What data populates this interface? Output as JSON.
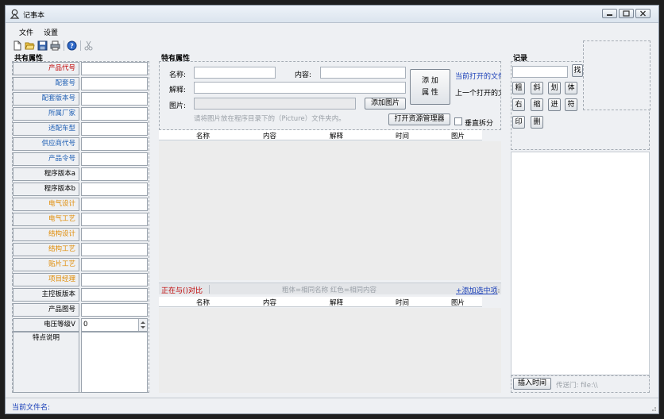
{
  "window": {
    "title": "记事本",
    "controls": [
      "minimize",
      "restore",
      "close"
    ]
  },
  "menu": {
    "items": [
      "文件",
      "设置"
    ]
  },
  "toolbar": {
    "icons": [
      "new-file-icon",
      "open-folder-icon",
      "save-icon",
      "print-icon",
      "help-icon",
      "cut-icon"
    ]
  },
  "left": {
    "title": "共有属性",
    "rows": [
      {
        "label": "产品代号",
        "color": "#c00000"
      },
      {
        "label": "配套号",
        "color": "#1f5fb4"
      },
      {
        "label": "配套版本号",
        "color": "#1f5fb4"
      },
      {
        "label": "所属厂家",
        "color": "#1f5fb4"
      },
      {
        "label": "适配车型",
        "color": "#1f5fb4"
      },
      {
        "label": "供应商代号",
        "color": "#1f5fb4"
      },
      {
        "label": "产品令号",
        "color": "#1f5fb4"
      },
      {
        "label": "程序版本a",
        "color": "#000000"
      },
      {
        "label": "程序版本b",
        "color": "#000000"
      },
      {
        "label": "电气设计",
        "color": "#e08a00"
      },
      {
        "label": "电气工艺",
        "color": "#e08a00"
      },
      {
        "label": "结构设计",
        "color": "#e08a00"
      },
      {
        "label": "结构工艺",
        "color": "#e08a00"
      },
      {
        "label": "贴片工艺",
        "color": "#e08a00"
      },
      {
        "label": "项目经理",
        "color": "#e08a00"
      },
      {
        "label": "主控板版本",
        "color": "#000000"
      },
      {
        "label": "产品图号",
        "color": "#000000"
      }
    ],
    "voltage": {
      "label": "电压等级V",
      "value": "0"
    },
    "notes_label": "特点说明"
  },
  "middle": {
    "title": "特有属性",
    "name_label": "名称:",
    "content_label": "内容:",
    "explain_label": "解释:",
    "image_label": "图片:",
    "add_attr_button": "添 加\n属 性",
    "add_image_button": "添加图片",
    "hint": "请将图片放在程序目录下的（Picture）文件夹内。",
    "open_explorer_button": "打开资源管理器",
    "vertical_split_label": "垂直拆分",
    "current_file_link": "当前打开的文件",
    "previous_file_text": "上一个打开的文",
    "grid_columns": [
      "名称",
      "内容",
      "解释",
      "时间",
      "图片"
    ],
    "compare_status": "正在与()对比",
    "legend_text": "粗体=相同名称  红色=相同内容",
    "add_selected_link": "+添加选中项"
  },
  "right": {
    "title": "记录",
    "find_button": "找",
    "format_buttons_row1": [
      "粗",
      "斜",
      "划",
      "体"
    ],
    "format_buttons_row2": [
      "右",
      "缩",
      "进",
      "符"
    ],
    "format_buttons_row3": [
      "印",
      "删"
    ],
    "insert_time_button": "插入时间",
    "portal_text": "传送门: file:\\\\"
  },
  "status": {
    "current_file_label": "当前文件名:"
  },
  "colors": {
    "link": "#1a3fb8",
    "red": "#c00000",
    "orange": "#e08a00",
    "blue": "#1f5fb4"
  }
}
